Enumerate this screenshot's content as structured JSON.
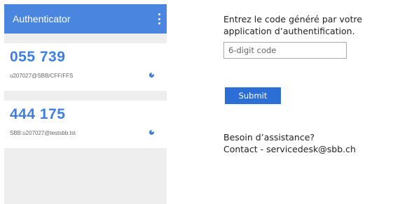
{
  "app": {
    "title": "Authenticator",
    "menu_icon": "kebab-menu-icon",
    "accounts": [
      {
        "code": "055 739",
        "name": "u207027@SBB/CFF/FFS",
        "timer_icon": "countdown-pie-icon"
      },
      {
        "code": "444 175",
        "name": "SBB:u207027@testsbb.tst",
        "timer_icon": "countdown-pie-icon"
      }
    ]
  },
  "form": {
    "prompt": "Entrez le code généré par votre application d’authentification.",
    "code_placeholder": "6-digit code",
    "submit_label": "Submit",
    "help_heading": "Besoin d’assistance?",
    "help_contact": "Contact - servicedesk@sbb.ch"
  },
  "colors": {
    "app_bar": "#4a86e0",
    "otp_code": "#3d7fe0",
    "submit_button": "#2b6fd6",
    "app_background": "#eeeeee"
  }
}
